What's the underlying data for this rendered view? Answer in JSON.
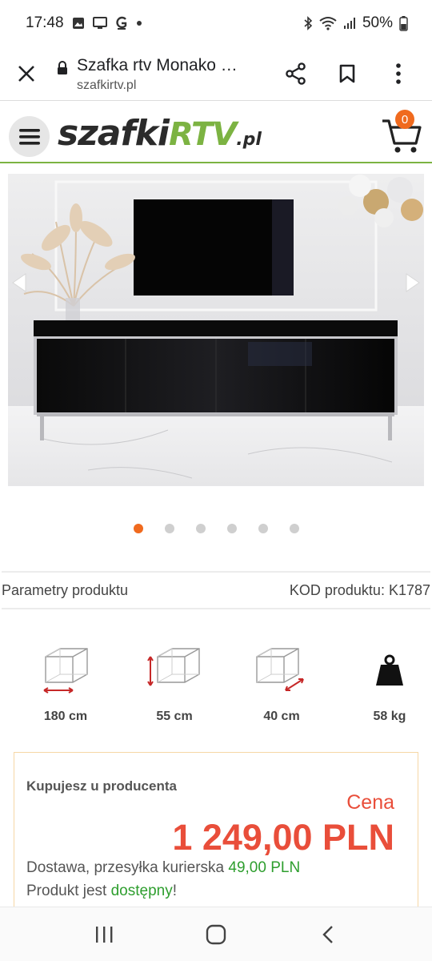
{
  "status": {
    "time": "17:48",
    "battery": "50%",
    "left_icons": [
      "gallery-icon",
      "screen-cast-icon",
      "g-app-icon",
      "dot-icon"
    ],
    "right_icons": [
      "bluetooth-icon",
      "wifi-icon",
      "signal-icon",
      "battery-icon"
    ]
  },
  "browser": {
    "title": "Szafka rtv Monako …",
    "domain": "szafkirtv.pl"
  },
  "header": {
    "logo_part1": "szafki",
    "logo_part2": "RTV",
    "logo_part3": ".pl",
    "cart_count": "0"
  },
  "gallery": {
    "slide_count": 6,
    "active_index": 0
  },
  "params": {
    "left": "Parametry produktu",
    "right": "KOD produktu: K1787"
  },
  "dimensions": [
    {
      "label": "180 cm",
      "icon": "width-box-icon"
    },
    {
      "label": "55 cm",
      "icon": "height-box-icon"
    },
    {
      "label": "40 cm",
      "icon": "depth-box-icon"
    },
    {
      "label": "58 kg",
      "icon": "weight-icon"
    }
  ],
  "price": {
    "title": "Kupujesz u producenta",
    "cena_label": "Cena",
    "amount": "1 249,00 PLN",
    "delivery_text": "Dostawa, przesyłka kurierska ",
    "delivery_price": "49,00 PLN",
    "availability_text": "Produkt jest ",
    "availability_status": "dostępny",
    "availability_suffix": "!"
  },
  "colors": {
    "accent_orange": "#f06a1e",
    "brand_green": "#7cb342",
    "price_red": "#e94e3a",
    "available_green": "#2e9e2e"
  }
}
